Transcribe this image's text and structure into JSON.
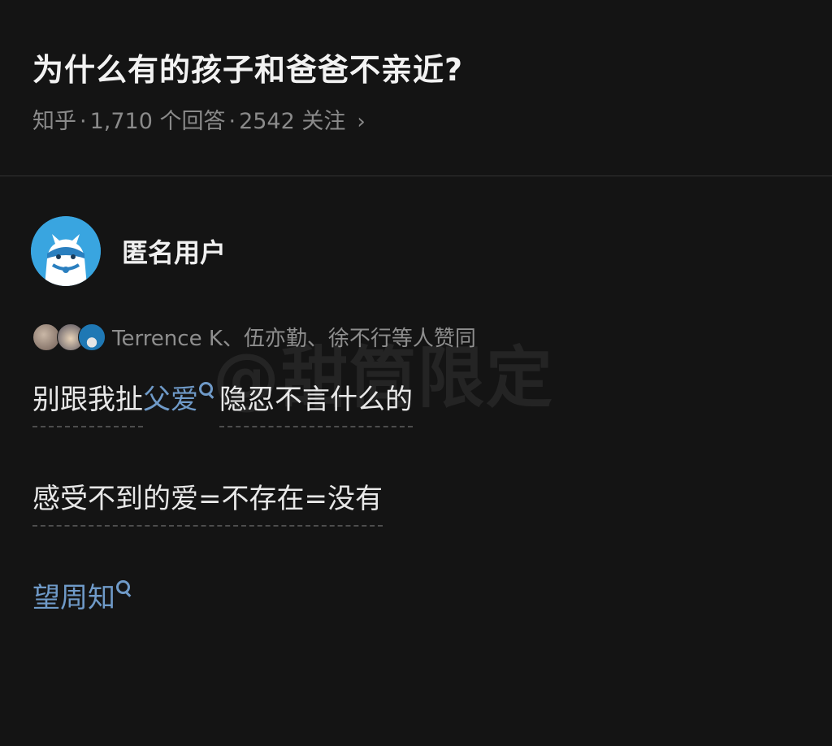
{
  "question": {
    "title": "为什么有的孩子和爸爸不亲近?",
    "source": "知乎",
    "answers": "1,710 个回答",
    "follows": "2542 关注",
    "chevron": "›"
  },
  "author": {
    "name": "匿名用户",
    "avatar_icon": "anonymous-bear-avatar"
  },
  "upvote": {
    "text": "Terrence K、伍亦勤、徐不行等人赞同"
  },
  "answer": {
    "p1_before": "别跟我扯",
    "p1_link": "父爱",
    "p1_after": "隐忍不言什么的",
    "p2": "感受不到的爱=不存在=没有",
    "p3_link": "望周知"
  },
  "watermark": "@甜筒限定",
  "colors": {
    "background": "#141414",
    "link": "#6f9ac8",
    "muted_text": "#8a8a8a",
    "avatar_bg": "#39a5e0"
  }
}
